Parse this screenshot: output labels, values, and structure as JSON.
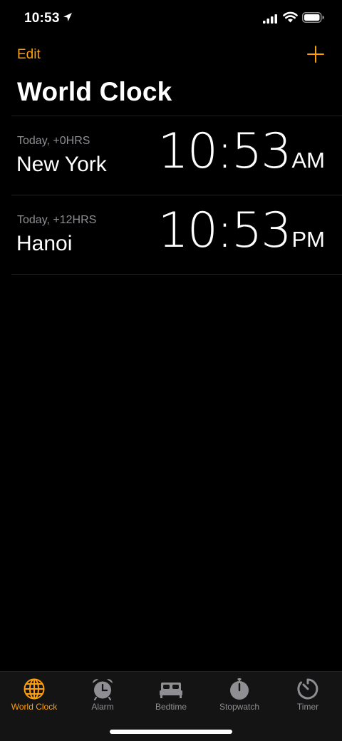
{
  "status_bar": {
    "time": "10:53",
    "icons": [
      "location-arrow-icon",
      "cellular-signal-icon",
      "wifi-icon",
      "battery-icon"
    ]
  },
  "nav": {
    "edit_label": "Edit",
    "add_icon": "plus-icon"
  },
  "title": "World Clock",
  "clocks": [
    {
      "offset": "Today, +0HRS",
      "city": "New York",
      "time": "10:53",
      "ampm": "AM"
    },
    {
      "offset": "Today, +12HRS",
      "city": "Hanoi",
      "time": "10:53",
      "ampm": "PM"
    }
  ],
  "tabs": [
    {
      "label": "World Clock",
      "icon": "globe-icon",
      "active": true
    },
    {
      "label": "Alarm",
      "icon": "alarm-clock-icon",
      "active": false
    },
    {
      "label": "Bedtime",
      "icon": "bed-icon",
      "active": false
    },
    {
      "label": "Stopwatch",
      "icon": "stopwatch-icon",
      "active": false
    },
    {
      "label": "Timer",
      "icon": "timer-icon",
      "active": false
    }
  ],
  "colors": {
    "accent": "#ff9f0a",
    "background": "#000000",
    "secondary_text": "#8e8e93",
    "tab_bar": "#141414"
  }
}
